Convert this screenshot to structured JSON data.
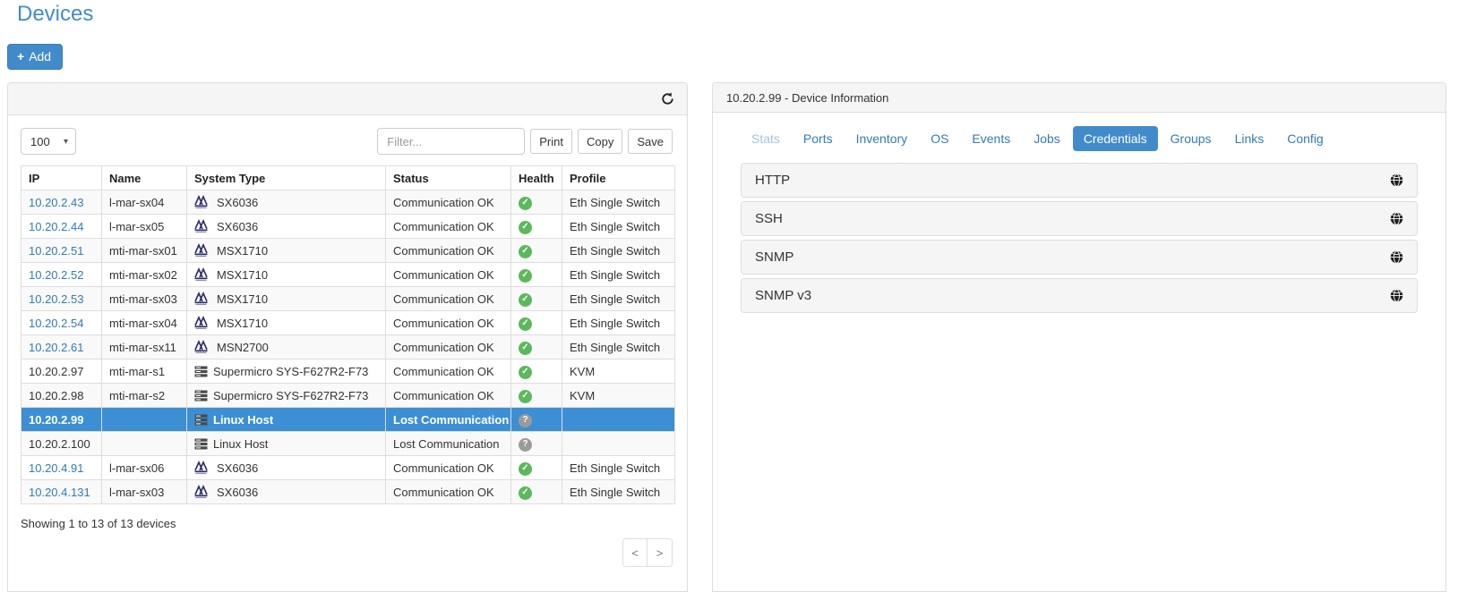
{
  "page": {
    "title": "Devices"
  },
  "toolbar": {
    "add_label": "Add",
    "add_plus": "+"
  },
  "left_panel": {
    "page_size": "100",
    "page_size_caret": "▾",
    "filter_placeholder": "Filter...",
    "buttons": {
      "print": "Print",
      "copy": "Copy",
      "save": "Save"
    },
    "table": {
      "columns": [
        "IP",
        "Name",
        "System Type",
        "Status",
        "Health",
        "Profile"
      ],
      "rows": [
        {
          "ip": "10.20.2.43",
          "ip_is_link": true,
          "name": "l-mar-sx04",
          "system_type": "SX6036",
          "type_icon": "switch-icon",
          "status": "Communication OK",
          "health": "ok",
          "profile": "Eth Single Switch",
          "selected": false
        },
        {
          "ip": "10.20.2.44",
          "ip_is_link": true,
          "name": "l-mar-sx05",
          "system_type": "SX6036",
          "type_icon": "switch-icon",
          "status": "Communication OK",
          "health": "ok",
          "profile": "Eth Single Switch",
          "selected": false
        },
        {
          "ip": "10.20.2.51",
          "ip_is_link": true,
          "name": "mti-mar-sx01",
          "system_type": "MSX1710",
          "type_icon": "switch-icon",
          "status": "Communication OK",
          "health": "ok",
          "profile": "Eth Single Switch",
          "selected": false
        },
        {
          "ip": "10.20.2.52",
          "ip_is_link": true,
          "name": "mti-mar-sx02",
          "system_type": "MSX1710",
          "type_icon": "switch-icon",
          "status": "Communication OK",
          "health": "ok",
          "profile": "Eth Single Switch",
          "selected": false
        },
        {
          "ip": "10.20.2.53",
          "ip_is_link": true,
          "name": "mti-mar-sx03",
          "system_type": "MSX1710",
          "type_icon": "switch-icon",
          "status": "Communication OK",
          "health": "ok",
          "profile": "Eth Single Switch",
          "selected": false
        },
        {
          "ip": "10.20.2.54",
          "ip_is_link": true,
          "name": "mti-mar-sx04",
          "system_type": "MSX1710",
          "type_icon": "switch-icon",
          "status": "Communication OK",
          "health": "ok",
          "profile": "Eth Single Switch",
          "selected": false
        },
        {
          "ip": "10.20.2.61",
          "ip_is_link": true,
          "name": "mti-mar-sx11",
          "system_type": "MSN2700",
          "type_icon": "switch-icon",
          "status": "Communication OK",
          "health": "ok",
          "profile": "Eth Single Switch",
          "selected": false
        },
        {
          "ip": "10.20.2.97",
          "ip_is_link": false,
          "name": "mti-mar-s1",
          "system_type": "Supermicro SYS-F627R2-F73",
          "type_icon": "server-icon",
          "status": "Communication OK",
          "health": "ok",
          "profile": "KVM",
          "selected": false
        },
        {
          "ip": "10.20.2.98",
          "ip_is_link": false,
          "name": "mti-mar-s2",
          "system_type": "Supermicro SYS-F627R2-F73",
          "type_icon": "server-icon",
          "status": "Communication OK",
          "health": "ok",
          "profile": "KVM",
          "selected": false
        },
        {
          "ip": "10.20.2.99",
          "ip_is_link": false,
          "name": "",
          "system_type": "Linux Host",
          "type_icon": "server-icon",
          "status": "Lost Communication",
          "health": "unknown",
          "profile": "",
          "selected": true
        },
        {
          "ip": "10.20.2.100",
          "ip_is_link": false,
          "name": "",
          "system_type": "Linux Host",
          "type_icon": "server-icon",
          "status": "Lost Communication",
          "health": "unknown",
          "profile": "",
          "selected": false
        },
        {
          "ip": "10.20.4.91",
          "ip_is_link": true,
          "name": "l-mar-sx06",
          "system_type": "SX6036",
          "type_icon": "switch-icon",
          "status": "Communication OK",
          "health": "ok",
          "profile": "Eth Single Switch",
          "selected": false
        },
        {
          "ip": "10.20.4.131",
          "ip_is_link": true,
          "name": "l-mar-sx03",
          "system_type": "SX6036",
          "type_icon": "switch-icon",
          "status": "Communication OK",
          "health": "ok",
          "profile": "Eth Single Switch",
          "selected": false
        }
      ]
    },
    "summary": "Showing 1 to 13 of 13 devices",
    "pagination": {
      "prev": "<",
      "next": ">"
    }
  },
  "right_panel": {
    "header": "10.20.2.99 - Device Information",
    "tabs": [
      {
        "label": "Stats",
        "state": "disabled"
      },
      {
        "label": "Ports",
        "state": "normal"
      },
      {
        "label": "Inventory",
        "state": "normal"
      },
      {
        "label": "OS",
        "state": "normal"
      },
      {
        "label": "Events",
        "state": "normal"
      },
      {
        "label": "Jobs",
        "state": "normal"
      },
      {
        "label": "Credentials",
        "state": "active"
      },
      {
        "label": "Groups",
        "state": "normal"
      },
      {
        "label": "Links",
        "state": "normal"
      },
      {
        "label": "Config",
        "state": "normal"
      }
    ],
    "sections": [
      {
        "label": "HTTP",
        "icon": "globe-icon"
      },
      {
        "label": "SSH",
        "icon": "globe-icon"
      },
      {
        "label": "SNMP",
        "icon": "globe-icon"
      },
      {
        "label": "SNMP v3",
        "icon": "globe-icon"
      }
    ]
  },
  "colors": {
    "accent_blue": "#428bca",
    "selected_row": "#3d8fd4",
    "link_blue": "#337ab7",
    "health_ok_green": "#5cb85c",
    "health_unknown_grey": "#9b9b9b",
    "panel_heading_grey": "#f5f5f5",
    "border_grey": "#dddddd"
  }
}
